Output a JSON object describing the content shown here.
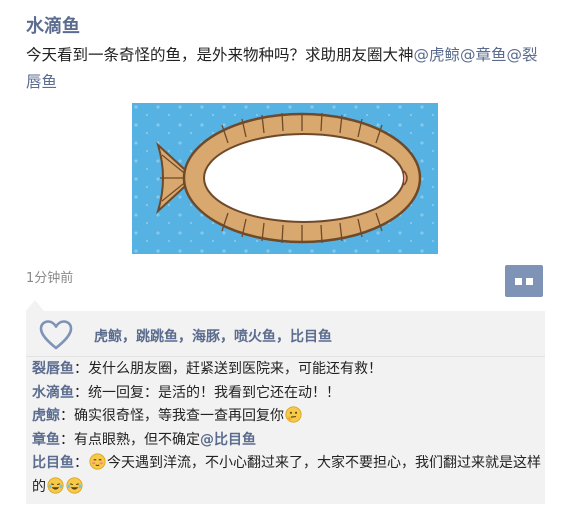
{
  "post": {
    "author": "水滴鱼",
    "text": "今天看到一条奇怪的鱼，是外来物种吗？求助朋友圈大神",
    "mentions": [
      "@虎鲸",
      "@章鱼",
      "@裂唇鱼"
    ],
    "time": "1分钟前"
  },
  "likes": {
    "names": [
      "虎鲸",
      "跳跳鱼",
      "海豚",
      "喷火鱼",
      "比目鱼"
    ],
    "separator": "，"
  },
  "comments": [
    {
      "name": "裂唇鱼",
      "sep": "：",
      "text": "发什么朋友圈，赶紧送到医院来，可能还有救！"
    },
    {
      "name": "水滴鱼",
      "sep": "：",
      "text": "统一回复：是活的！我看到它还在动！！"
    },
    {
      "name": "虎鲸",
      "sep": "：",
      "text": "确实很奇怪，等我查一查再回复你"
    },
    {
      "name": "章鱼",
      "sep": "：",
      "text": "有点眼熟，但不确定",
      "mention": "@比目鱼"
    },
    {
      "name": "比目鱼",
      "sep": "：",
      "text_a": "今天遇到洋流，不小心翻过来了，大家不要担心，我们翻过来就是这样的"
    }
  ],
  "icons": {
    "like": "heart-outline-icon",
    "more": "comment-more-icon",
    "emoji_think": "thinking-face-emoji",
    "emoji_shy": "shy-face-emoji",
    "emoji_laugh": "laughing-crying-emoji"
  },
  "colors": {
    "name_blue": "#5b6c8f",
    "button_blue": "#7f93b6",
    "comment_bg": "#f2f2f2",
    "photo_bg": "#56b2e2",
    "fish_body": "#d8a86e"
  }
}
